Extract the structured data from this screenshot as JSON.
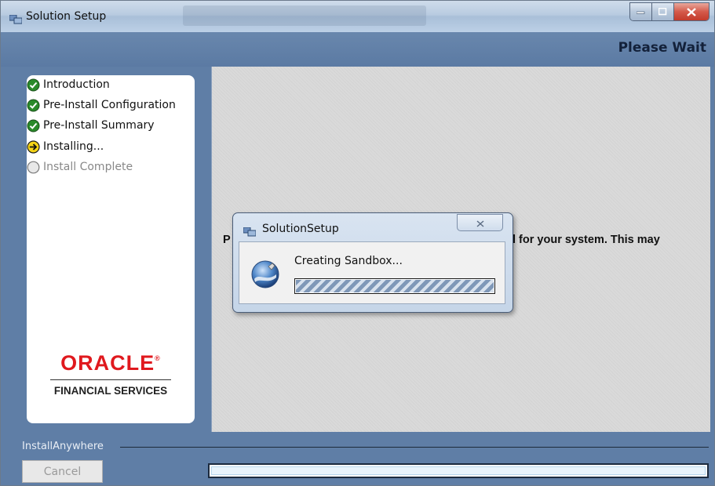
{
  "window": {
    "title": "Solution Setup",
    "header": "Please Wait"
  },
  "steps": [
    {
      "label": "Introduction",
      "status": "complete"
    },
    {
      "label": "Pre-Install Configuration",
      "status": "complete"
    },
    {
      "label": "Pre-Install Summary",
      "status": "complete"
    },
    {
      "label": "Installing...",
      "status": "current"
    },
    {
      "label": "Install Complete",
      "status": "pending"
    }
  ],
  "branding": {
    "logo_text": "ORACLE",
    "subtitle": "FINANCIAL SERVICES"
  },
  "content": {
    "message_start": "P",
    "message_visible": "l for your system.  This may"
  },
  "footer": {
    "installer_label": "InstallAnywhere",
    "cancel_label": "Cancel"
  },
  "dialog": {
    "title": "SolutionSetup",
    "message": "Creating Sandbox...",
    "progress_indeterminate": true
  },
  "colors": {
    "header_band": "#5f7ea6",
    "complete_icon": "#2a8a2a",
    "current_icon": "#f5d417",
    "oracle_red": "#e0191e"
  }
}
